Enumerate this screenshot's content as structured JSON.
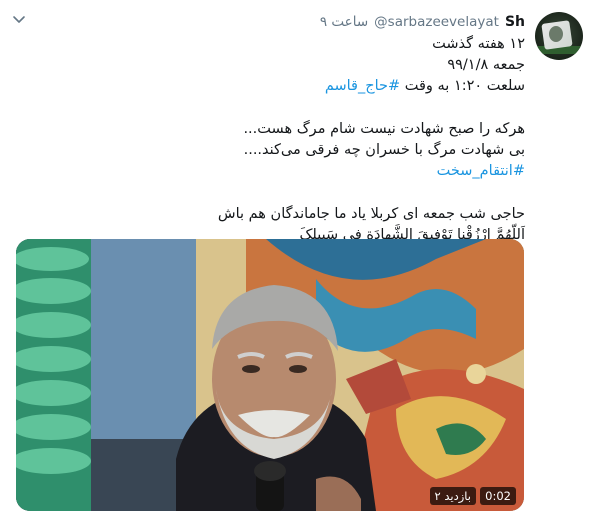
{
  "tweet": {
    "display_name": "Sh",
    "handle": "@sarbazeevelayat",
    "time_ago": "۹ ساعت",
    "lines": [
      "۱۲ هفته گذشت",
      "جمعه ۹۹/۱/۸",
      "سلعت ۱:۲۰ به وقت"
    ],
    "hashtag_1": "#حاج_قاسم",
    "paragraph_2": [
      "هرکه را صبح شهادت نیست شام مرگ هست...",
      "بی شهادت مرگ با خسران چه فرقی می‌کند...."
    ],
    "hashtag_2": "#انتقام_سخت",
    "paragraph_3": [
      "حاجی شب جمعه ای کربلا یاد ما جاماندگان هم باش",
      "اَللّهُمَّ ارْزُقْنا تَوْفیقَ الشَّهادَةِ فی سَبیلِکَ"
    ]
  },
  "video": {
    "duration": "0:02",
    "views": "۲ بازدید"
  }
}
